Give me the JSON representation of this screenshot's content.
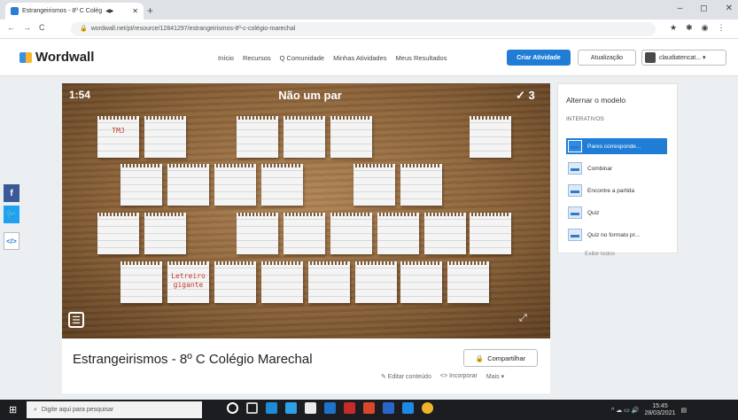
{
  "browser": {
    "tab_title": "Estrangeirismos - 8º C Colég",
    "tab_extra": "◀▶",
    "tab_close": "✕",
    "new_tab": "+",
    "window_controls": [
      "–",
      "◻",
      "✕"
    ],
    "nav_buttons": [
      "←",
      "→",
      "C"
    ],
    "url": "wordwall.net/pt/resource/12841297/estrangeirismos-8º-c-colégio-marechal",
    "ext_icons": [
      "★",
      "✱",
      "◉",
      "⋮"
    ]
  },
  "site": {
    "logo_text": "Wordwall",
    "nav": [
      "Início",
      "Recursos",
      "Q Comunidade",
      "Minhas Atividades",
      "Meus Resultados"
    ],
    "create_button": "Criar Atividade",
    "upgrade_button": "Atualização",
    "user_button": "claudiatencat...  ▾"
  },
  "share_side": {
    "facebook": "f",
    "twitter": "🐦",
    "embed": "</>"
  },
  "game": {
    "timer": "1:54",
    "title": "Não um par",
    "score": "✓ 3",
    "card_texts": {
      "tmj": "TMJ",
      "letreiro": "Letreiro gigante"
    },
    "menu_icon": "☰",
    "fullscreen_icon": "⤢"
  },
  "activity": {
    "title": "Estrangeirismos - 8º C Colégio Marechal",
    "share_button": "Compartilhar",
    "links": [
      "✎ Editar conteúdo",
      "<> Incorporar",
      "Mais ▾"
    ]
  },
  "template_panel": {
    "title": "Alternar o modelo",
    "subtitle": "INTERATIVOS",
    "options": [
      "Pares correspondе...",
      "Combinar",
      "Encontre a partida",
      "Quiz",
      "Quiz no formato pr..."
    ],
    "show_all": "Exibir todos"
  },
  "taskbar": {
    "start": "⊞",
    "search_placeholder": "Digite aqui para pesquisar",
    "tray_time": "15:45",
    "tray_date": "28/03/2021"
  }
}
